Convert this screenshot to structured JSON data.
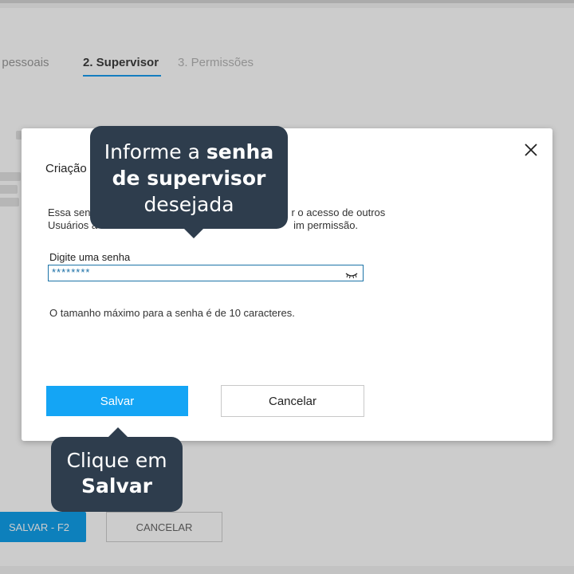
{
  "background": {
    "steps": [
      "dos pessoais",
      "2. Supervisor",
      "3. Permissões"
    ],
    "save_button": "SALVAR - F2",
    "cancel_button": "CANCELAR"
  },
  "modal": {
    "title": "Criação",
    "description_line1": "Essa sen",
    "description_line1_end": "r o acesso de outros",
    "description_line2": "Usuários à",
    "description_line2_end": "im permissão.",
    "field_label": "Digite uma senha",
    "field_value": "********",
    "hint": "O tamanho máximo para a senha é de 10 caracteres.",
    "save_label": "Salvar",
    "cancel_label": "Cancelar",
    "close_icon": "close-icon"
  },
  "callouts": {
    "top": {
      "line1_normal": "Informe a ",
      "line1_bold": "senha",
      "line2_bold": "de supervisor",
      "line3_normal": "desejada"
    },
    "bottom": {
      "line1_normal": "Clique em",
      "line2_bold": "Salvar"
    }
  },
  "colors": {
    "accent": "#14a5f5",
    "callout": "#2e3d4d"
  },
  "icons": {
    "eye": "eye-closed-icon",
    "close": "close-icon"
  }
}
